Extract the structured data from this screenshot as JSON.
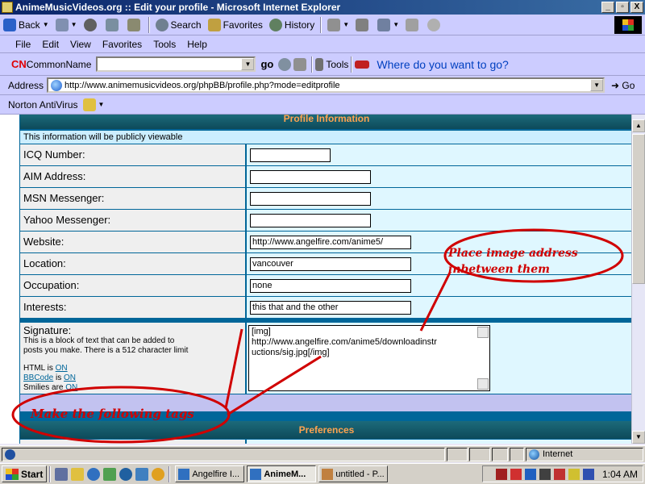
{
  "window": {
    "title": "AnimeMusicVideos.org :: Edit your profile - Microsoft Internet Explorer",
    "controls": [
      "_",
      "▫",
      "X"
    ]
  },
  "toolbar": {
    "back": "Back",
    "search": "Search",
    "favorites": "Favorites",
    "history": "History"
  },
  "menu": [
    "File",
    "Edit",
    "View",
    "Favorites",
    "Tools",
    "Help"
  ],
  "cnbar": {
    "logo": "CN",
    "name": "CommonName",
    "go": "go",
    "tools": "Tools",
    "prompt": "Where do you want to go?"
  },
  "address": {
    "label": "Address",
    "url": "http://www.animemusicvideos.org/phpBB/profile.php?mode=editprofile",
    "go": "Go"
  },
  "norton": {
    "label": "Norton AntiVirus"
  },
  "profile": {
    "header": "Profile Information",
    "public_note": "This information will be publicly viewable",
    "fields": [
      {
        "label": "ICQ Number:",
        "value": ""
      },
      {
        "label": "AIM Address:",
        "value": ""
      },
      {
        "label": "MSN Messenger:",
        "value": ""
      },
      {
        "label": "Yahoo Messenger:",
        "value": ""
      },
      {
        "label": "Website:",
        "value": "http://www.angelfire.com/anime5/"
      },
      {
        "label": "Location:",
        "value": "vancouver"
      },
      {
        "label": "Occupation:",
        "value": "none"
      },
      {
        "label": "Interests:",
        "value": "this that and the other"
      }
    ],
    "signature": {
      "label": "Signature:",
      "description_1": "This is a block of text that can be added to",
      "description_2": "posts you make. There is a 512 character limit",
      "html_prefix": "HTML is ",
      "html_state": "ON",
      "bbcode_link": "BBCode",
      "bbcode_mid": " is ",
      "bbcode_state": "ON",
      "smilies_prefix": "Smilies are ",
      "smilies_state": "ON",
      "lines": [
        "[img]",
        "http://www.angelfire.com/anime5/downloadinstr",
        "uctions/sig.jpg[/img]"
      ]
    },
    "prefs_header": "Preferences"
  },
  "annotations": {
    "note1_line1": "Place image address",
    "note1_line2": "inbetween them",
    "note2": "Make the following tags",
    "color": "#d00000"
  },
  "status": {
    "zone": "Internet"
  },
  "taskbar": {
    "start": "Start",
    "tasks": [
      {
        "label": "Angelfire I...",
        "active": false
      },
      {
        "label": "AnimeM...",
        "active": true
      },
      {
        "label": "untitled - P...",
        "active": false
      }
    ],
    "clock": "1:04 AM"
  }
}
